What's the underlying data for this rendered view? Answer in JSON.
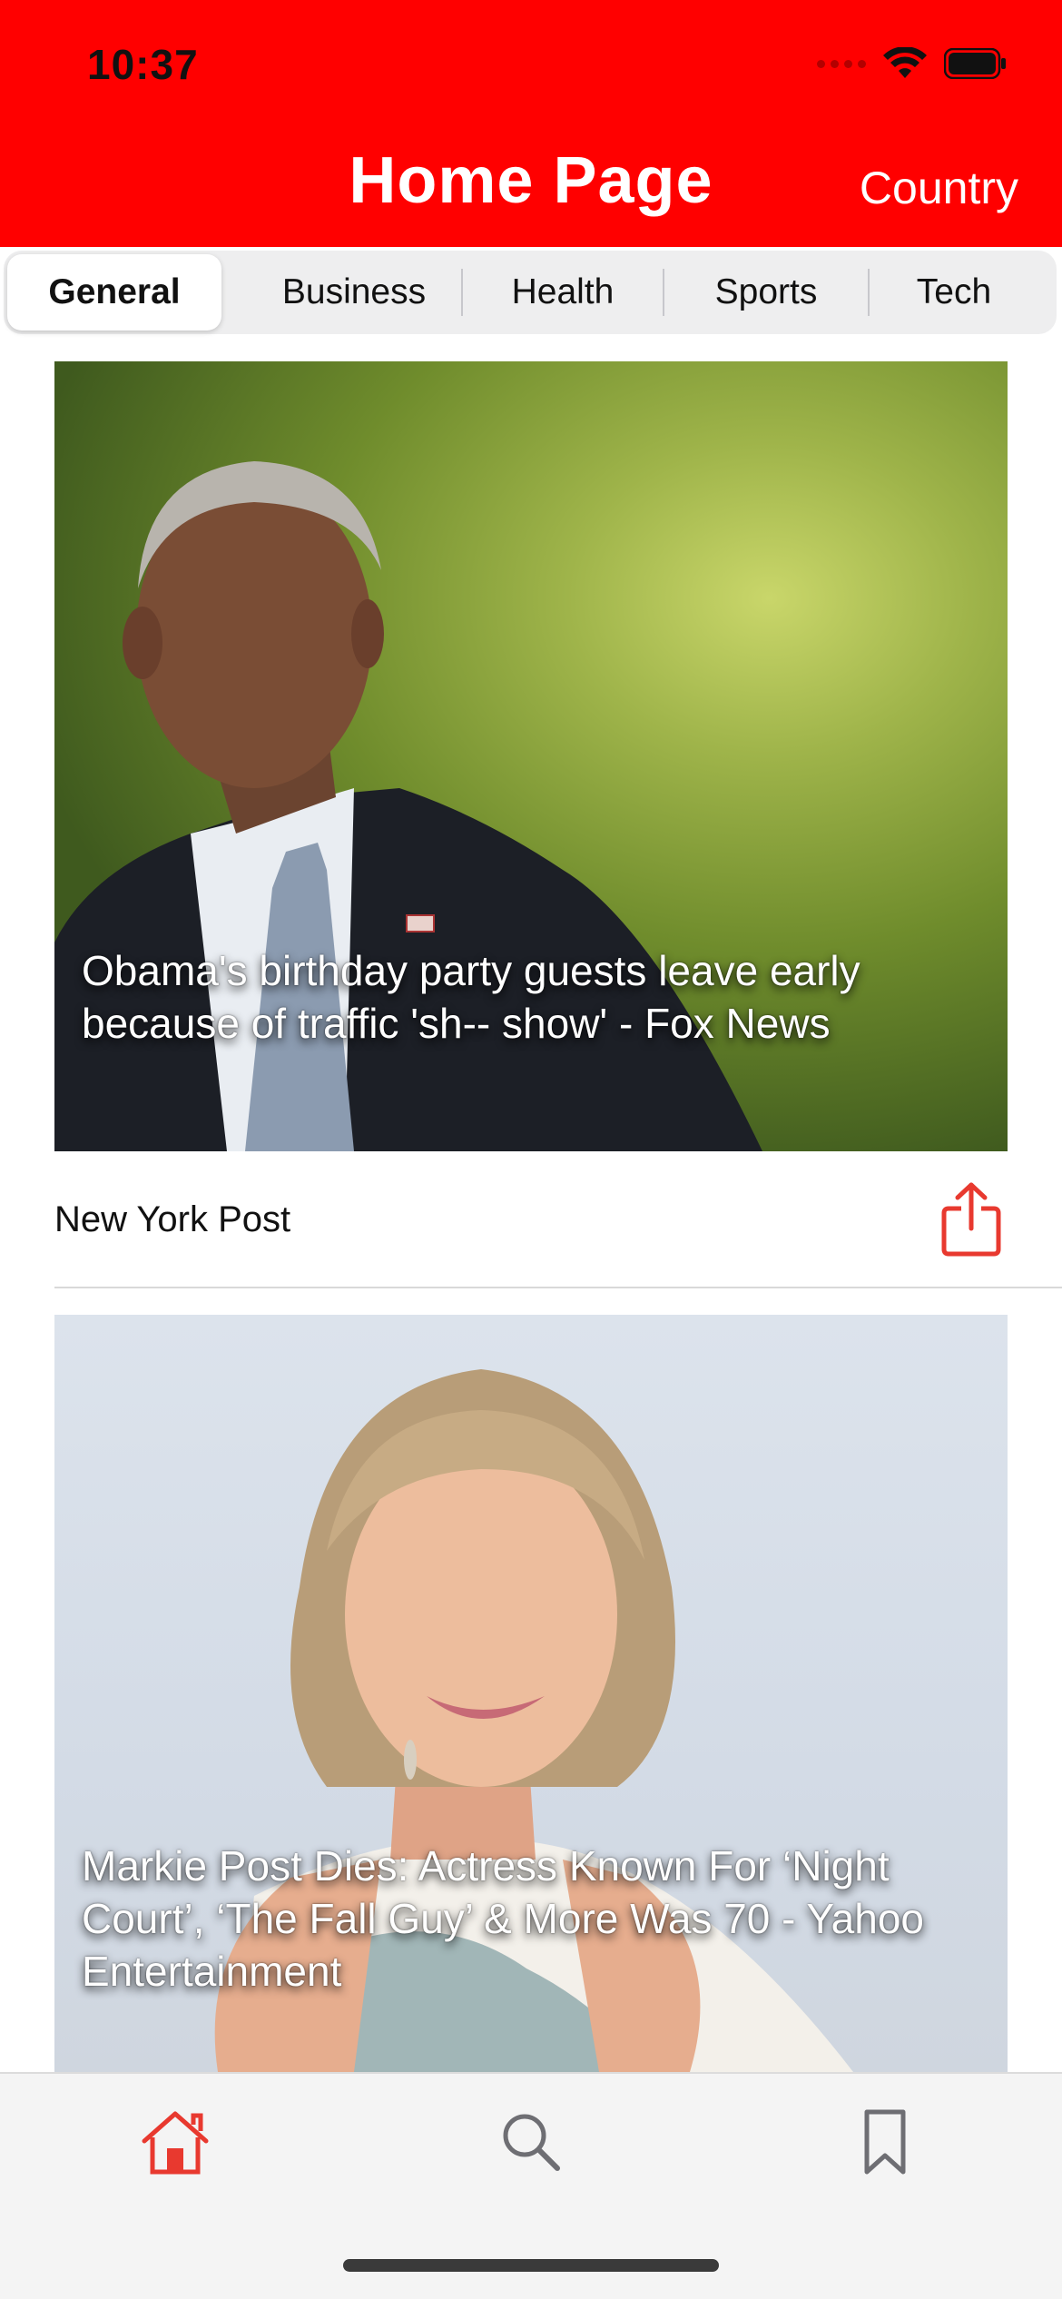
{
  "status_bar": {
    "time": "10:37"
  },
  "header": {
    "title": "Home Page",
    "country_label": "Country"
  },
  "segments": [
    {
      "label": "General",
      "selected": true
    },
    {
      "label": "Business",
      "selected": false
    },
    {
      "label": "Health",
      "selected": false
    },
    {
      "label": "Sports",
      "selected": false
    },
    {
      "label": "Tech",
      "selected": false
    }
  ],
  "articles": [
    {
      "headline": "Obama's birthday party guests leave early because of traffic 'sh-- show' - Fox News",
      "source": "New York Post"
    },
    {
      "headline": "Markie Post Dies: Actress Known For ‘Night Court’, ‘The Fall Guy’ & More Was 70 - Yahoo Entertainment"
    }
  ],
  "tabbar": {
    "tabs": [
      {
        "icon": "home-icon",
        "active": true
      },
      {
        "icon": "search-icon",
        "active": false
      },
      {
        "icon": "bookmark-icon",
        "active": false
      }
    ]
  },
  "colors": {
    "accent": "#ff0000",
    "tab_active": "#e8392f",
    "tab_inactive": "#6e6e73"
  }
}
